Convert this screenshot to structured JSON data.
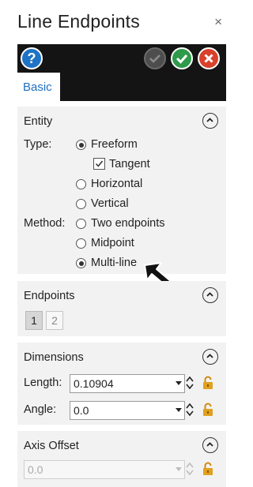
{
  "window": {
    "title": "Line Endpoints",
    "close_glyph": "×"
  },
  "toolbar": {
    "help_glyph": "?",
    "icons": [
      "help-icon",
      "apply-icon",
      "ok-icon",
      "cancel-icon"
    ]
  },
  "tabs": [
    {
      "label": "Basic",
      "active": true
    }
  ],
  "entity": {
    "title": "Entity",
    "type_label": "Type:",
    "method_label": "Method:",
    "type_options": [
      "Freeform",
      "Horizontal",
      "Vertical"
    ],
    "type_selected": "Freeform",
    "tangent_label": "Tangent",
    "tangent_checked": true,
    "method_options": [
      "Two endpoints",
      "Midpoint",
      "Multi-line"
    ],
    "method_selected": "Multi-line"
  },
  "endpoints": {
    "title": "Endpoints",
    "buttons": [
      "1",
      "2"
    ],
    "selected": "1"
  },
  "dimensions": {
    "title": "Dimensions",
    "length_label": "Length:",
    "length_value": "0.10904",
    "angle_label": "Angle:",
    "angle_value": "0.0"
  },
  "axis_offset": {
    "title": "Axis Offset",
    "value": "0.0",
    "disabled": true
  },
  "colors": {
    "toolbar_bg": "#141414",
    "panel_bg": "#f2f2f2",
    "accent": "#1f6fc0",
    "ok": "#2f9a4a",
    "cancel": "#d9402b",
    "lock": "#e0a020"
  }
}
